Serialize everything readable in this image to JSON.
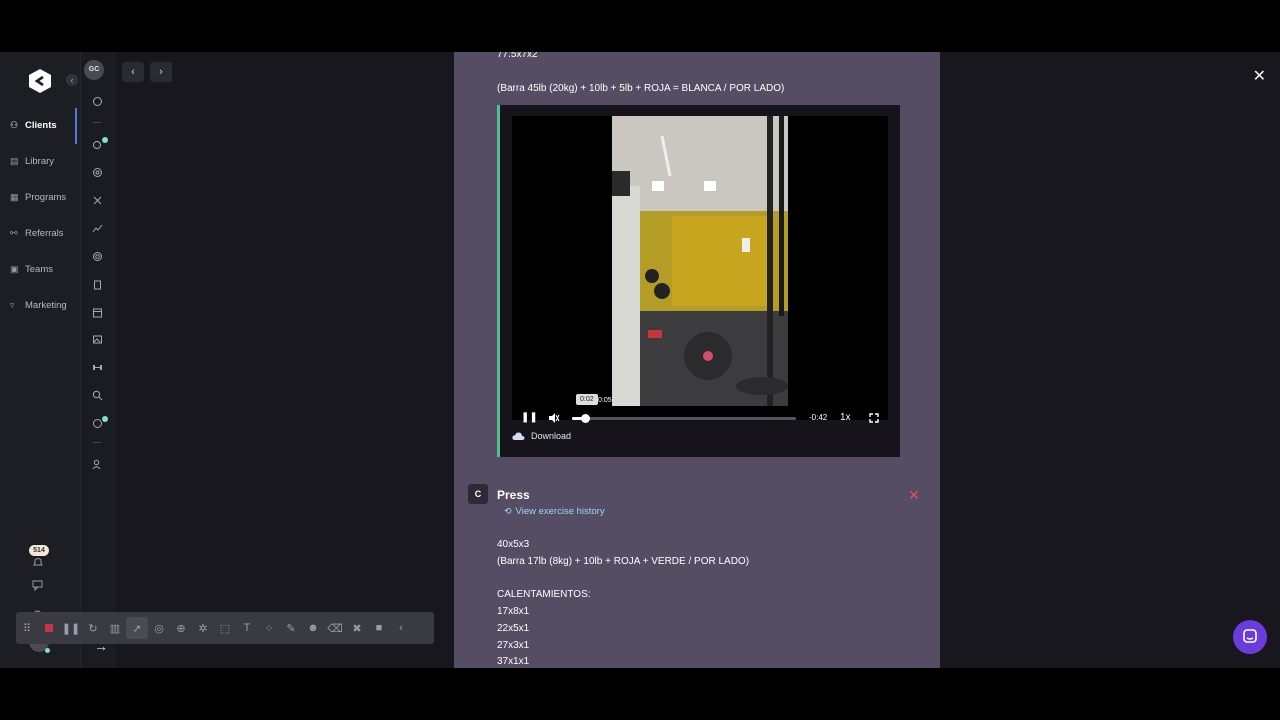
{
  "sidebar": {
    "items": [
      {
        "label": "Clients",
        "icon": "clients-icon"
      },
      {
        "label": "Library",
        "icon": "library-icon"
      },
      {
        "label": "Programs",
        "icon": "programs-icon"
      },
      {
        "label": "Referrals",
        "icon": "referrals-icon"
      },
      {
        "label": "Teams",
        "icon": "teams-icon"
      },
      {
        "label": "Marketing",
        "icon": "marketing-icon"
      }
    ],
    "notification_badge": "514",
    "bottom_avatar": "CT"
  },
  "client_panel": {
    "avatar": "GC"
  },
  "modal": {
    "top_partial": "77.5x7x2",
    "bar_note": "(Barra 45lb (20kg) + 10lb + 5lb + ROJA = BLANCA / POR LADO)",
    "video": {
      "tooltip_time": "0:02",
      "elapsed": "0:05",
      "remaining": "-0:42",
      "speed": "1x",
      "progress": 0.05,
      "download_label": "Download"
    },
    "exercise": {
      "badge": "C",
      "name": "Press",
      "history_link": "View exercise history",
      "lines": [
        "40x5x3",
        "(Barra 17lb (8kg) + 10lb + ROJA + VERDE / POR LADO)",
        "",
        "CALENTAMIENTOS:",
        "17x8x1",
        "22x5x1",
        "27x3x1",
        "37x1x1"
      ]
    }
  },
  "colors": {
    "accent_green": "#4bc28e",
    "modal_bg": "#544d63",
    "delete_red": "#e0524f",
    "link": "#9fd4ff"
  }
}
